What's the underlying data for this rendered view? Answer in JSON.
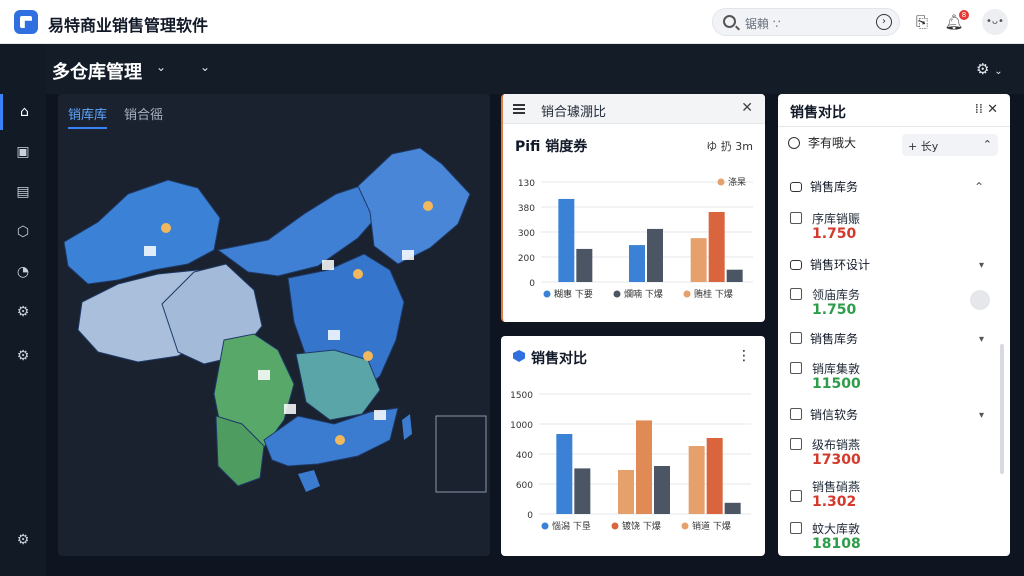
{
  "app": {
    "title": "易特商业销售管理软件",
    "search_placeholder": "锯賴 ∵",
    "notification_count": "8",
    "avatar": "•ᴗ•"
  },
  "header": {
    "title": "多仓库管理"
  },
  "rail": {
    "items": [
      "home-icon",
      "message-icon",
      "document-icon",
      "box-icon",
      "chart-icon",
      "settings-icon",
      "gear-icon"
    ],
    "bottom": "gear-icon"
  },
  "map": {
    "tabs": [
      "销库库",
      "销合徭"
    ],
    "regions": [
      {
        "name": "xinjiang",
        "color": "#3b82d6"
      },
      {
        "name": "tibet",
        "color": "#a9bfdc"
      },
      {
        "name": "qinghai",
        "color": "#a3bbd8"
      },
      {
        "name": "inner-mongolia",
        "color": "#3f7fd4"
      },
      {
        "name": "northeast",
        "color": "#4a86d8"
      },
      {
        "name": "east-china",
        "color": "#3575cc"
      },
      {
        "name": "sichuan",
        "color": "#58a86a"
      },
      {
        "name": "yunnan",
        "color": "#4f9c60"
      },
      {
        "name": "central",
        "color": "#5aa5a8"
      },
      {
        "name": "south",
        "color": "#3b7bd0"
      }
    ]
  },
  "card1": {
    "header": "销合璩淜比",
    "title": "Pifi 销度券",
    "options": "ゆ 扔 3m",
    "legend_top": "涤杲",
    "chart_data": {
      "type": "bar",
      "title": "Pifi 销度券",
      "categories": [
        "",
        "",
        ""
      ],
      "yticks": [
        "0",
        "200",
        "300",
        "380",
        "130"
      ],
      "ylim": [
        0,
        130
      ],
      "series": [
        {
          "name": "糊 下爆",
          "color": "#3b82d6",
          "values": [
            108,
            0,
            0
          ]
        },
        {
          "name": "爛 下爆",
          "color": "#4b5563",
          "values": [
            43,
            0,
            0
          ]
        }
      ],
      "bars": [
        {
          "group": 0,
          "values": [
            108,
            43
          ],
          "colors": [
            "#3b82d6",
            "#4b5563"
          ]
        },
        {
          "group": 1,
          "values": [
            48,
            69
          ],
          "colors": [
            "#3b82d6",
            "#4b5563"
          ]
        },
        {
          "group": 2,
          "values": [
            57,
            91,
            16
          ],
          "colors": [
            "#e6a06c",
            "#d9643e",
            "#4b5563"
          ]
        }
      ],
      "legend": [
        {
          "label": "糊惠 下要",
          "color": "#3b82d6"
        },
        {
          "label": "爛喃 下爆",
          "color": "#4b5563"
        },
        {
          "label": "贿桂 下爆",
          "color": "#e6a06c"
        }
      ]
    }
  },
  "card2": {
    "title": "销售对比",
    "chart_data": {
      "type": "bar",
      "title": "销售对比",
      "categories": [
        "",
        "",
        ""
      ],
      "yticks": [
        "0",
        "600",
        "400",
        "1000",
        "1500"
      ],
      "ylim": [
        0,
        1500
      ],
      "bars": [
        {
          "group": 0,
          "values": [
            1000,
            570
          ],
          "colors": [
            "#3b82d6",
            "#4b5563"
          ]
        },
        {
          "group": 1,
          "values": [
            550,
            1170,
            600
          ],
          "colors": [
            "#e6a06c",
            "#e08a55",
            "#4b5563"
          ]
        },
        {
          "group": 2,
          "values": [
            850,
            950,
            140
          ],
          "colors": [
            "#e6a06c",
            "#d9643e",
            "#4b5563"
          ]
        }
      ],
      "legend": [
        {
          "label": "惱潟 下垦",
          "color": "#3b82d6"
        },
        {
          "label": "镀饶 下爆",
          "color": "#d9643e"
        },
        {
          "label": "销道 下爆",
          "color": "#e6a06c"
        }
      ]
    }
  },
  "rpanel": {
    "title": "销售对比",
    "icons": "⁞⁞   ✕",
    "filter": "李有哦大",
    "chip": "+ 长y",
    "groups": [
      "销售库务",
      "销售环设计",
      "销售库务",
      "销信软务"
    ],
    "rows": [
      {
        "name": "序库销赈",
        "value": "1.750",
        "color": "#d33a2c"
      },
      {
        "name": "领庙库务",
        "value": "1.750",
        "color": "#2e9d4a"
      },
      {
        "name": "销库集敦",
        "value": "11500",
        "color": "#2e9d4a"
      },
      {
        "name": "级布销燕",
        "value": "17300",
        "color": "#d33a2c"
      },
      {
        "name": "销售硝燕",
        "value": "1.302",
        "color": "#d33a2c"
      },
      {
        "name": "蚊大库敦",
        "value": "18108",
        "color": "#2e9d4a"
      }
    ]
  }
}
